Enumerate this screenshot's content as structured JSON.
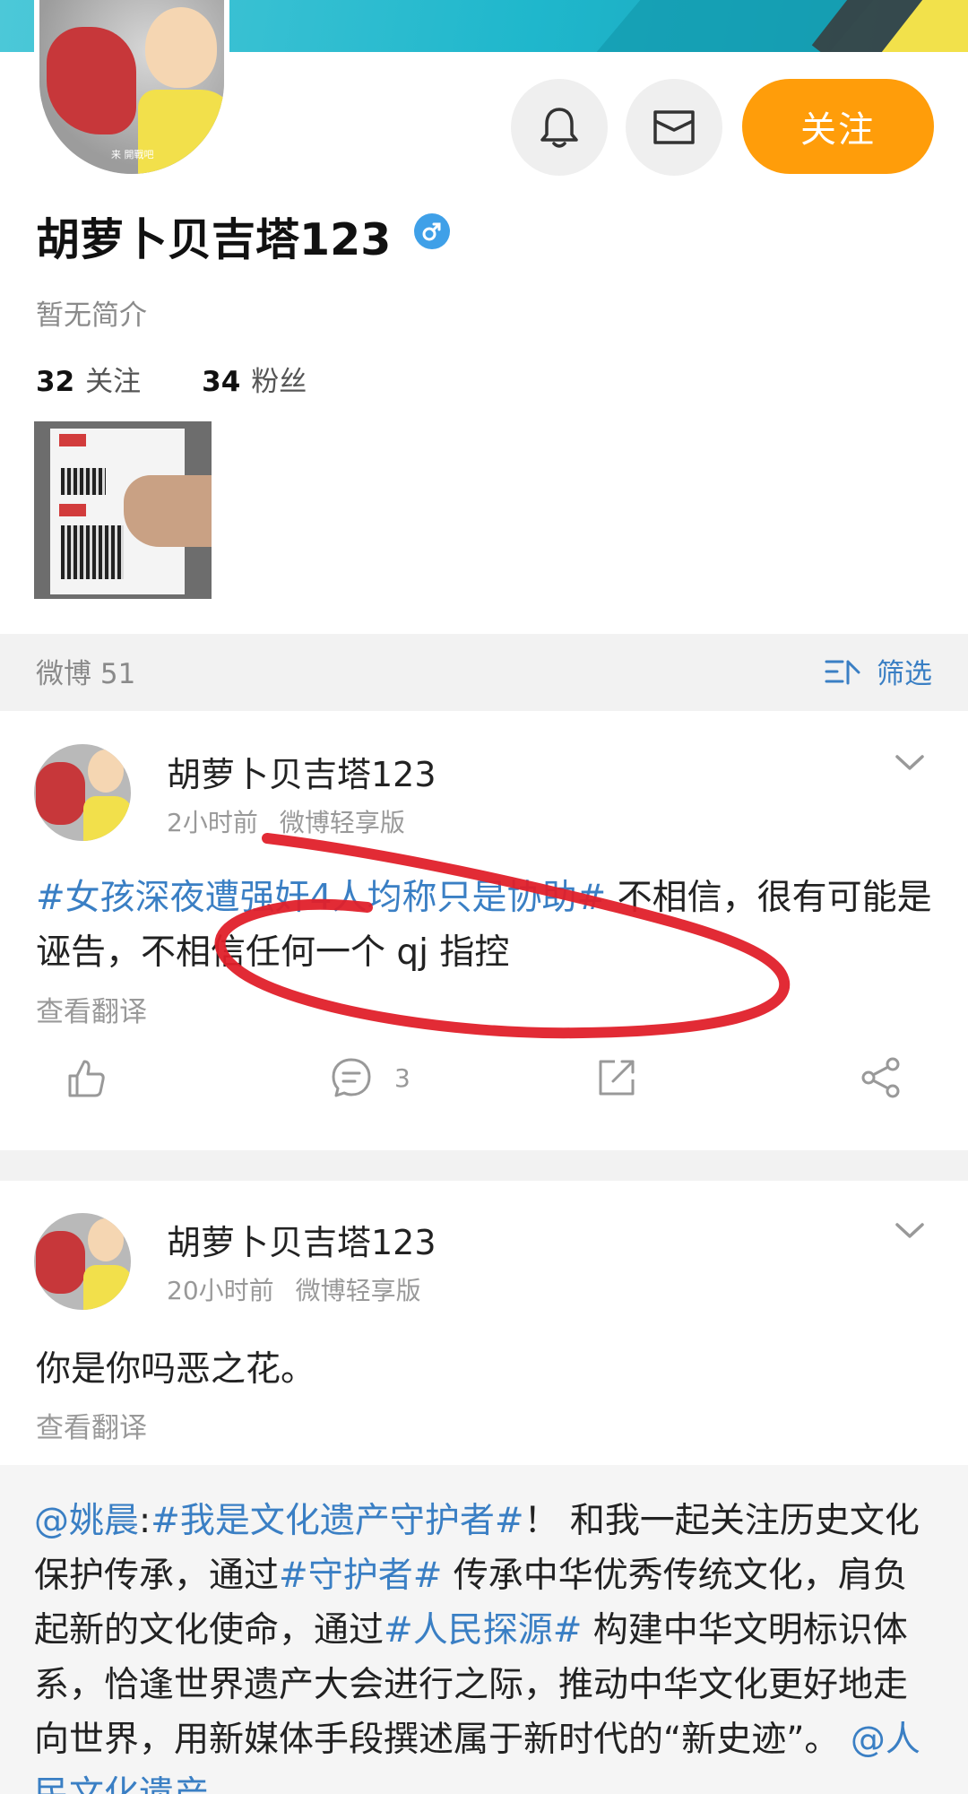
{
  "profile": {
    "avatar_caption": "来 開戰吧",
    "username": "胡萝卜贝吉塔123",
    "gender_icon": "male-icon",
    "bio": "暂无简介",
    "following_count": "32",
    "following_label": "关注",
    "followers_count": "34",
    "followers_label": "粉丝",
    "follow_button": "关注"
  },
  "tabs": {
    "weibo_label": "微博 51",
    "filter_label": "筛选"
  },
  "posts": [
    {
      "author": "胡萝卜贝吉塔123",
      "time": "2小时前",
      "source": "微博轻享版",
      "hashtag": "#女孩深夜遭强奸4人均称只是协助#",
      "text": " 不相信，很有可能是诬告，不相信任何一个 qj 指控",
      "translate": "查看翻译",
      "comments": "3"
    },
    {
      "author": "胡萝卜贝吉塔123",
      "time": "20小时前",
      "source": "微博轻享版",
      "text": "你是你吗恶之花。",
      "translate": "查看翻译"
    }
  ],
  "repost": {
    "mention1": "@姚晨",
    "sep": ":",
    "tag1": "#我是文化遗产守护者#",
    "t1": "！ 和我一起关注历史文化保护传承，通过",
    "tag2": "#守护者#",
    "t2": " 传承中华优秀传统文化，肩负起新的文化使命，通过",
    "tag3": "#人民探源#",
    "t3": " 构建中华文明标识体系，恰逢世界遗产大会进行之际，推动中华文化更好地走向世界，用新媒体手段撰述属于新时代的“新史迹”。",
    "mention2": "@人民文化遗产"
  },
  "colors": {
    "accent_orange": "#ff9d0a",
    "link_blue": "#3a7fc4",
    "annotation_red": "#e0202a"
  }
}
